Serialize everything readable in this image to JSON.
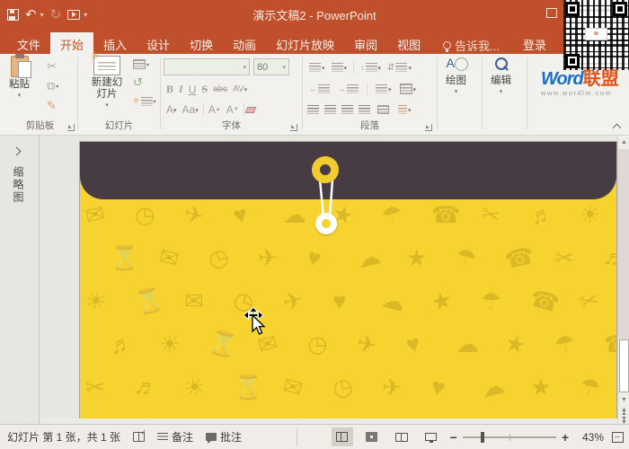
{
  "colors": {
    "titlebar": "#C0502B",
    "active_tab_text": "#C2552E",
    "ribbon_bg": "#F3F1ED",
    "workspace_bg": "#E5E8E1",
    "slide_yellow": "#F7D330",
    "flap_dark": "#473C44",
    "brand_blue": "#1A6FC4",
    "brand_red": "#E2541C"
  },
  "titlebar": {
    "title": "演示文稿2 - PowerPoint",
    "qat": {
      "undo_glyph": "↶",
      "redo_glyph": "↻",
      "drop_glyph": "▾"
    }
  },
  "tabs": {
    "items": [
      {
        "label": "文件",
        "active": false
      },
      {
        "label": "开始",
        "active": true
      },
      {
        "label": "插入",
        "active": false
      },
      {
        "label": "设计",
        "active": false
      },
      {
        "label": "切换",
        "active": false
      },
      {
        "label": "动画",
        "active": false
      },
      {
        "label": "幻灯片放映",
        "active": false
      },
      {
        "label": "审阅",
        "active": false
      },
      {
        "label": "视图",
        "active": false
      }
    ],
    "tell_me": "告诉我...",
    "sign_in": "登录"
  },
  "ribbon": {
    "clipboard": {
      "label": "剪贴板",
      "paste": "粘贴",
      "cut_glyph": "✂",
      "copy_glyph": "⧉"
    },
    "slides": {
      "label": "幻灯片",
      "new_slide": "新建幻灯片"
    },
    "font": {
      "label": "字体",
      "font_name_value": "",
      "font_size_value": "80",
      "bold": "B",
      "italic": "I",
      "underline": "U",
      "strike": "S",
      "clear_abc": "abc",
      "spacing": "AV",
      "color": "A",
      "case": "Aa",
      "grow": "A",
      "shrink": "A"
    },
    "paragraph": {
      "label": "段落"
    },
    "drawing": {
      "label": "绘图",
      "icon_letter": "A"
    },
    "editing": {
      "label": "编辑"
    }
  },
  "brand": {
    "word": "Word",
    "lm": "联盟",
    "url": "www.wordlm.com"
  },
  "sidebar": {
    "thumbnails_label": "缩略图"
  },
  "statusbar": {
    "slide_counter": "幻灯片 第 1 张，共 1 张",
    "notes": "备注",
    "comments": "批注",
    "zoom_value": "43%",
    "zoom_minus": "−",
    "zoom_plus": "+"
  },
  "slide": {
    "pattern_icons": [
      "✉",
      "◷",
      "✈",
      "♥",
      "☁",
      "★",
      "☂",
      "☎",
      "✂",
      "♬",
      "☀",
      "⌛"
    ]
  }
}
